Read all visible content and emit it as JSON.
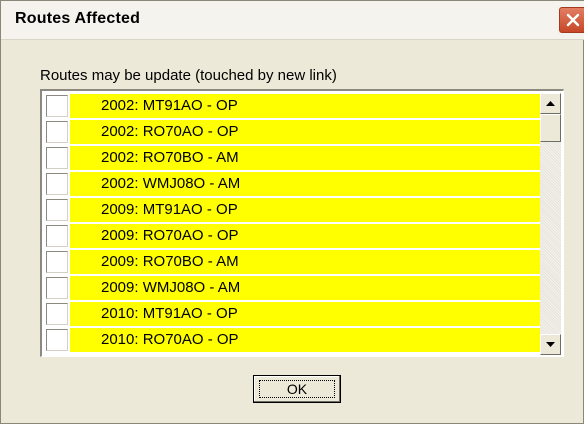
{
  "window": {
    "title": "Routes Affected",
    "close_icon": "close-icon"
  },
  "caption": "Routes may be update (touched by new link)",
  "routes": [
    {
      "label": "2002: MT91AO - OP",
      "checked": false
    },
    {
      "label": "2002: RO70AO - OP",
      "checked": false
    },
    {
      "label": "2002: RO70BO - AM",
      "checked": false
    },
    {
      "label": "2002: WMJ08O - AM",
      "checked": false
    },
    {
      "label": "2009: MT91AO - OP",
      "checked": false
    },
    {
      "label": "2009: RO70AO - OP",
      "checked": false
    },
    {
      "label": "2009: RO70BO - AM",
      "checked": false
    },
    {
      "label": "2009: WMJ08O - AM",
      "checked": false
    },
    {
      "label": "2010: MT91AO - OP",
      "checked": false
    },
    {
      "label": "2010: RO70AO - OP",
      "checked": false
    }
  ],
  "scrollbar": {
    "up_icon": "arrow-up-icon",
    "down_icon": "arrow-down-icon"
  },
  "buttons": {
    "ok_label": "OK"
  },
  "colors": {
    "highlight": "#ffff00",
    "dialog_bg": "#ece9d8",
    "close_red": "#c64727"
  }
}
